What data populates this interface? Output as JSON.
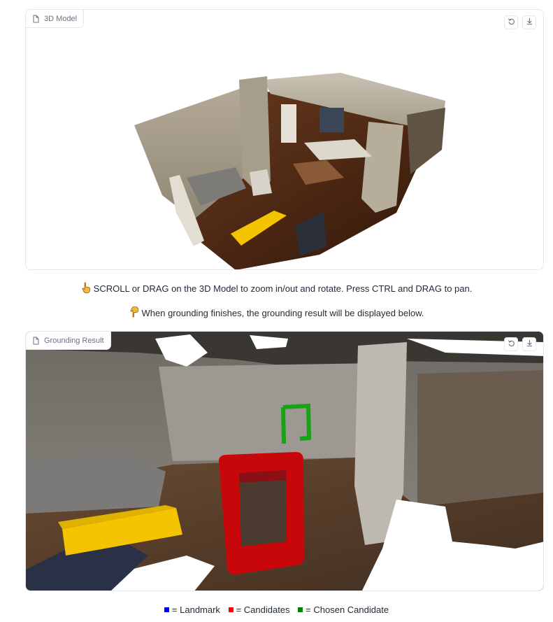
{
  "model_panel": {
    "label": "3D Model",
    "icon": "file-icon",
    "buttons": [
      "reset-view-icon",
      "download-icon"
    ]
  },
  "hints": {
    "rotate": "SCROLL or DRAG on the 3D Model to zoom in/out and rotate. Press CTRL and DRAG to pan.",
    "result": "When grounding finishes, the grounding result will be displayed below."
  },
  "result_panel": {
    "label": "Grounding Result",
    "icon": "file-icon",
    "buttons": [
      "reset-view-icon",
      "download-icon"
    ]
  },
  "legend": {
    "landmark": "= Landmark",
    "candidates": "= Candidates",
    "chosen": "= Chosen Candidate",
    "colors": {
      "landmark": "#0000ff",
      "candidates": "#ff0000",
      "chosen": "#008000"
    }
  },
  "colors": {
    "highlight_yellow": "#f5c400",
    "candidate_red": "#c8070b",
    "chosen_green": "#16a316"
  }
}
